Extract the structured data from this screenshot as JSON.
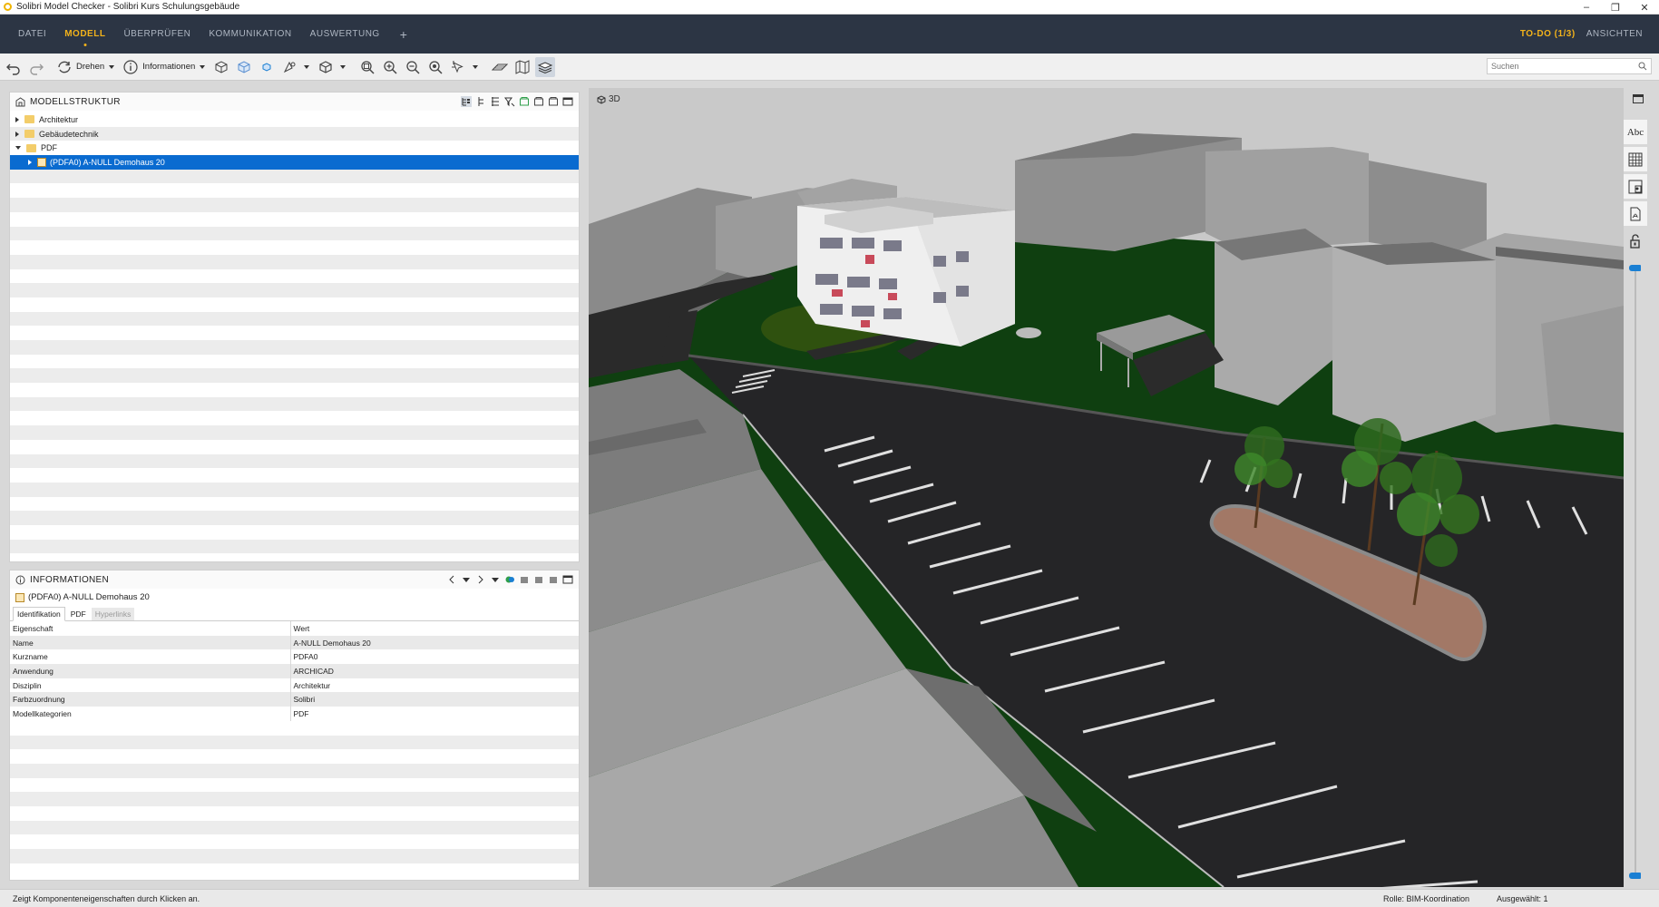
{
  "window": {
    "title": "Solibri Model Checker - Solibri Kurs Schulungsgebäude",
    "controls": [
      "–",
      "❐",
      "✕"
    ]
  },
  "menu": {
    "items": [
      "DATEI",
      "MODELL",
      "ÜBERPRÜFEN",
      "KOMMUNIKATION",
      "AUSWERTUNG"
    ],
    "active": "MODELL",
    "plus": "+",
    "todo": "TO-DO (1/3)",
    "ansichten": "ANSICHTEN"
  },
  "toolbar": {
    "rotate_label": "Drehen",
    "info_label": "Informationen",
    "search_placeholder": "Suchen"
  },
  "model_structure": {
    "title": "MODELLSTRUKTUR",
    "items": [
      {
        "label": "Architektur",
        "expanded": false
      },
      {
        "label": "Gebäudetechnik",
        "expanded": false
      },
      {
        "label": "PDF",
        "expanded": true
      },
      {
        "label": "(PDFA0) A-NULL Demohaus 20",
        "selected": true
      }
    ]
  },
  "information": {
    "title": "INFORMATIONEN",
    "component": "(PDFA0) A-NULL Demohaus 20",
    "tabs": [
      "Identifikation",
      "PDF",
      "Hyperlinks"
    ],
    "active_tab": "Identifikation",
    "columns": [
      "Eigenschaft",
      "Wert"
    ],
    "rows": [
      [
        "Name",
        "A-NULL Demohaus 20"
      ],
      [
        "Kurzname",
        "PDFA0"
      ],
      [
        "Anwendung",
        "ARCHICAD"
      ],
      [
        "Disziplin",
        "Architektur"
      ],
      [
        "Farbzuordnung",
        "Solibri"
      ],
      [
        "Modellkategorien",
        "PDF"
      ]
    ]
  },
  "viewport": {
    "label": "3D",
    "side_tools": [
      "Abc"
    ]
  },
  "status": {
    "hint": "Zeigt Komponenteneigenschaften durch Klicken an.",
    "role": "Rolle: BIM-Koordination",
    "selected": "Ausgewählt: 1"
  },
  "colors": {
    "menu_bg": "#2c3544",
    "accent": "#f2b21b",
    "selection": "#0a6bd0",
    "grass": "#0f3f10",
    "asphalt": "#252527"
  }
}
